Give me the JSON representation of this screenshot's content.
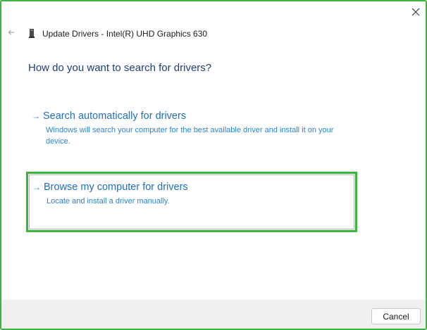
{
  "window": {
    "title": "Update Drivers - Intel(R) UHD Graphics 630",
    "close_icon": "close-icon",
    "back_icon": "back-arrow-icon",
    "device_icon": "device-icon"
  },
  "main": {
    "question": "How do you want to search for drivers?",
    "options": [
      {
        "arrow": "→",
        "title": "Search automatically for drivers",
        "description": "Windows will search your computer for the best available driver and install it on your device."
      },
      {
        "arrow": "→",
        "title": "Browse my computer for drivers",
        "description": "Locate and install a driver manually."
      }
    ]
  },
  "footer": {
    "cancel_label": "Cancel"
  },
  "colors": {
    "highlight_border": "#3cb53c",
    "link_blue": "#1f6fbf",
    "heading_blue": "#1f3d7a"
  }
}
